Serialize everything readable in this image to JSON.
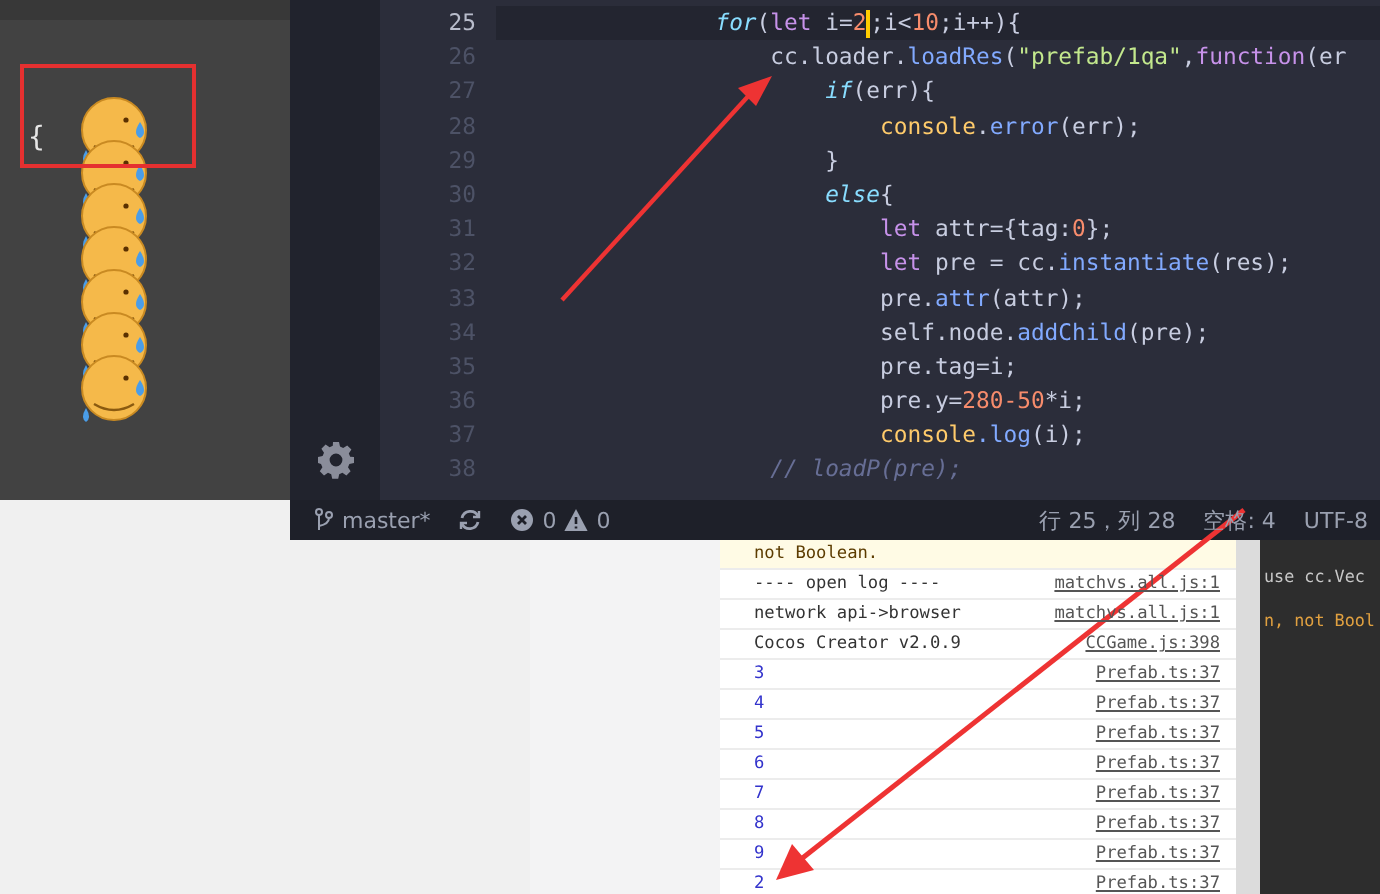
{
  "preview": {
    "brace": "{"
  },
  "editor": {
    "lines": [
      {
        "number": "25",
        "current": true,
        "tokens": [
          {
            "kind": "ctrl",
            "text": "for"
          },
          {
            "kind": "plain",
            "text": "("
          },
          {
            "kind": "kw",
            "text": "let"
          },
          {
            "kind": "plain",
            "text": " i="
          },
          {
            "kind": "num",
            "text": "2",
            "cursor": true
          },
          {
            "kind": "plain",
            "text": ";i<"
          },
          {
            "kind": "num",
            "text": "10"
          },
          {
            "kind": "plain",
            "text": ";i++){"
          }
        ],
        "children": [
          {
            "number": "26",
            "current": false,
            "tokens": [
              {
                "kind": "plain",
                "text": "cc.loader."
              },
              {
                "kind": "fn",
                "text": "loadRes"
              },
              {
                "kind": "plain",
                "text": "("
              },
              {
                "kind": "str",
                "text": "\"prefab/1qa\""
              },
              {
                "kind": "plain",
                "text": ","
              },
              {
                "kind": "kw",
                "text": "function"
              },
              {
                "kind": "plain",
                "text": "(er"
              }
            ],
            "children": [
              {
                "number": "27",
                "current": false,
                "tokens": [
                  {
                    "kind": "ctrl",
                    "text": "if"
                  },
                  {
                    "kind": "plain",
                    "text": "(err){"
                  }
                ],
                "children": [
                  {
                    "number": "28",
                    "current": false,
                    "tokens": [
                      {
                        "kind": "obj",
                        "text": "console"
                      },
                      {
                        "kind": "plain",
                        "text": "."
                      },
                      {
                        "kind": "fn",
                        "text": "error"
                      },
                      {
                        "kind": "plain",
                        "text": "(err);"
                      }
                    ]
                  }
                ]
              },
              {
                "number": "29",
                "current": false,
                "tokens": [
                  {
                    "kind": "plain",
                    "text": "}"
                  }
                ]
              },
              {
                "number": "30",
                "current": false,
                "tokens": [
                  {
                    "kind": "ctrl",
                    "text": "else"
                  },
                  {
                    "kind": "plain",
                    "text": "{"
                  }
                ],
                "children": [
                  {
                    "number": "31",
                    "current": false,
                    "tokens": [
                      {
                        "kind": "kw",
                        "text": "let"
                      },
                      {
                        "kind": "plain",
                        "text": " attr={tag:"
                      },
                      {
                        "kind": "num",
                        "text": "0"
                      },
                      {
                        "kind": "plain",
                        "text": "};"
                      }
                    ]
                  },
                  {
                    "number": "32",
                    "current": false,
                    "tokens": [
                      {
                        "kind": "kw",
                        "text": "let"
                      },
                      {
                        "kind": "plain",
                        "text": " pre = cc."
                      },
                      {
                        "kind": "fn",
                        "text": "instantiate"
                      },
                      {
                        "kind": "plain",
                        "text": "(res);"
                      }
                    ]
                  },
                  {
                    "number": "33",
                    "current": false,
                    "tokens": [
                      {
                        "kind": "plain",
                        "text": "pre."
                      },
                      {
                        "kind": "fn",
                        "text": "attr"
                      },
                      {
                        "kind": "plain",
                        "text": "(attr);"
                      }
                    ]
                  },
                  {
                    "number": "34",
                    "current": false,
                    "tokens": [
                      {
                        "kind": "plain",
                        "text": "self.node."
                      },
                      {
                        "kind": "fn",
                        "text": "addChild"
                      },
                      {
                        "kind": "plain",
                        "text": "(pre);"
                      }
                    ]
                  },
                  {
                    "number": "35",
                    "current": false,
                    "tokens": [
                      {
                        "kind": "plain",
                        "text": "pre.tag=i;"
                      }
                    ]
                  },
                  {
                    "number": "36",
                    "current": false,
                    "tokens": [
                      {
                        "kind": "plain",
                        "text": "pre.y="
                      },
                      {
                        "kind": "num",
                        "text": "280-50"
                      },
                      {
                        "kind": "plain",
                        "text": "*i;"
                      }
                    ]
                  },
                  {
                    "number": "37",
                    "current": false,
                    "tokens": [
                      {
                        "kind": "obj",
                        "text": "console"
                      },
                      {
                        "kind": "fn",
                        "text": ".log"
                      },
                      {
                        "kind": "plain",
                        "text": "(i);"
                      }
                    ]
                  }
                ]
              }
            ]
          },
          {
            "number": "38",
            "current": false,
            "tokens": [
              {
                "kind": "cmt",
                "text": "// loadP(pre);"
              }
            ]
          }
        ]
      }
    ]
  },
  "status_bar": {
    "branch": "master*",
    "errors": "0",
    "warnings": "0",
    "position": "行 25，列 28",
    "indent": "空格: 4",
    "encoding": "UTF-8"
  },
  "console": {
    "rows": [
      {
        "kind": "warn",
        "text": "not Boolean."
      },
      {
        "kind": "info",
        "text": "---- open log ----",
        "source": "matchvs.all.js:1"
      },
      {
        "kind": "info",
        "text": "network api->browser",
        "source": "matchvs.all.js:1"
      },
      {
        "kind": "info",
        "text": "Cocos Creator v2.0.9",
        "source": "CCGame.js:398"
      },
      {
        "kind": "log",
        "text": "3",
        "source": "Prefab.ts:37"
      },
      {
        "kind": "log",
        "text": "4",
        "source": "Prefab.ts:37"
      },
      {
        "kind": "log",
        "text": "5",
        "source": "Prefab.ts:37"
      },
      {
        "kind": "log",
        "text": "6",
        "source": "Prefab.ts:37"
      },
      {
        "kind": "log",
        "text": "7",
        "source": "Prefab.ts:37"
      },
      {
        "kind": "log",
        "text": "8",
        "source": "Prefab.ts:37"
      },
      {
        "kind": "log",
        "text": "9",
        "source": "Prefab.ts:37"
      },
      {
        "kind": "log",
        "text": "2",
        "source": "Prefab.ts:37"
      }
    ]
  },
  "background_log": [
    {
      "kind": "plain",
      "text": "use cc.Vec"
    },
    {
      "kind": "warn",
      "text": "n, not Bool"
    }
  ]
}
